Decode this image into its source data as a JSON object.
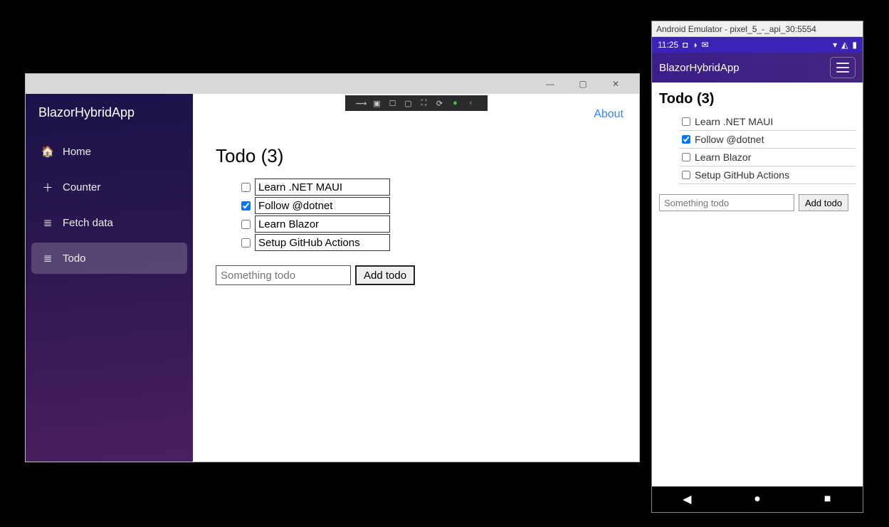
{
  "desktop": {
    "app_title": "BlazorHybridApp",
    "window_controls": {
      "min": "—",
      "max": "▢",
      "close": "✕"
    },
    "nav": [
      {
        "label": "Home",
        "icon": "🏠",
        "active": false,
        "name": "sidebar-item-home"
      },
      {
        "label": "Counter",
        "icon": "＋",
        "active": false,
        "name": "sidebar-item-counter"
      },
      {
        "label": "Fetch data",
        "icon": "≣",
        "active": false,
        "name": "sidebar-item-fetch-data"
      },
      {
        "label": "Todo",
        "icon": "≣",
        "active": true,
        "name": "sidebar-item-todo"
      }
    ],
    "about_link": "About",
    "page_title": "Todo (3)",
    "todos": [
      {
        "text": "Learn .NET MAUI",
        "checked": false
      },
      {
        "text": "Follow @dotnet",
        "checked": true
      },
      {
        "text": "Learn Blazor",
        "checked": false
      },
      {
        "text": "Setup GitHub Actions",
        "checked": false
      }
    ],
    "new_todo_placeholder": "Something todo",
    "add_button": "Add todo"
  },
  "emulator": {
    "window_title": "Android Emulator - pixel_5_-_api_30:5554",
    "status_time": "11:25",
    "status_icons_left": [
      "◘",
      "◑",
      "✉"
    ],
    "status_icons_right": [
      "▾",
      "◭",
      "▮"
    ],
    "app_title": "BlazorHybridApp",
    "page_title": "Todo (3)",
    "todos": [
      {
        "text": "Learn .NET MAUI",
        "checked": false
      },
      {
        "text": "Follow @dotnet",
        "checked": true
      },
      {
        "text": "Learn Blazor",
        "checked": false
      },
      {
        "text": "Setup GitHub Actions",
        "checked": false
      }
    ],
    "new_todo_placeholder": "Something todo",
    "add_button": "Add todo",
    "android_nav": {
      "back": "◀",
      "home": "●",
      "recent": "■"
    }
  }
}
